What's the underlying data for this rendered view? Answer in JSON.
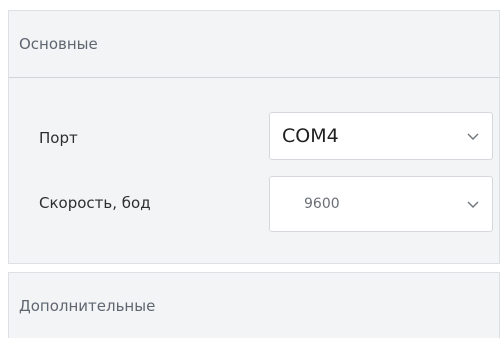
{
  "sections": {
    "main": {
      "title": "Основные"
    },
    "extra": {
      "title": "Дополнительные"
    }
  },
  "fields": {
    "port": {
      "label": "Порт",
      "value": "COM4"
    },
    "speed": {
      "label": "Скорость, бод",
      "value": "9600"
    }
  },
  "icons": {
    "dropdown": "chevron-down-icon"
  }
}
